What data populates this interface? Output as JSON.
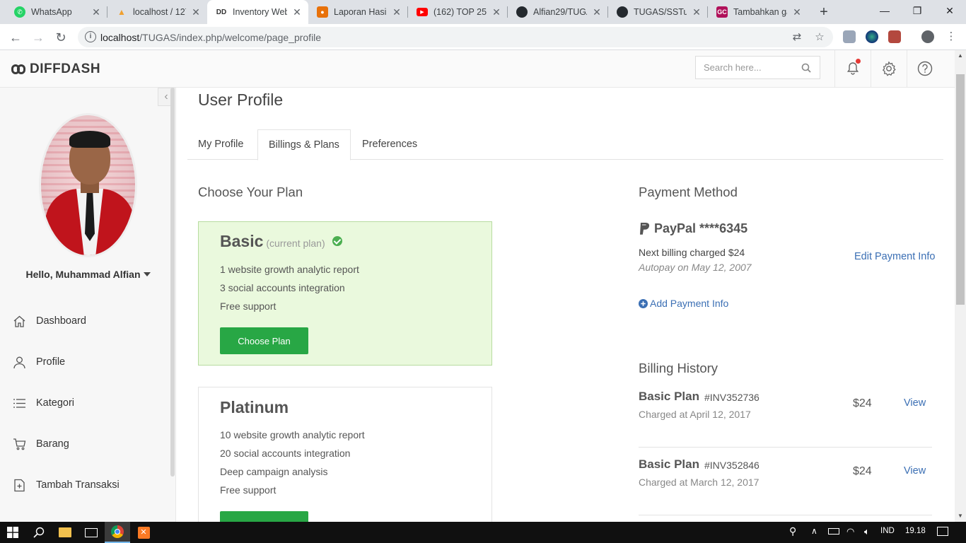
{
  "browser": {
    "tabs": [
      {
        "title": "WhatsApp",
        "favicon": "whatsapp-icon",
        "color": "#25d366"
      },
      {
        "title": "localhost / 127",
        "favicon": "phpmyadmin-icon",
        "color": "#f0a030"
      },
      {
        "title": "Inventory Web",
        "favicon": "dd",
        "color": "#333333",
        "active": true
      },
      {
        "title": "Laporan Hasil",
        "favicon": "person-icon",
        "color": "#e8710a"
      },
      {
        "title": "(162) TOP 25 C",
        "favicon": "youtube-icon",
        "color": "#ff0000"
      },
      {
        "title": "Alfian29/TUGA",
        "favicon": "github-icon",
        "color": "#24292e"
      },
      {
        "title": "TUGAS/SSTug",
        "favicon": "github-icon",
        "color": "#24292e"
      },
      {
        "title": "Tambahkan ga",
        "favicon": "gc",
        "color": "#b0115a"
      }
    ],
    "url_host": "localhost",
    "url_path": "/TUGAS/index.php/welcome/page_profile"
  },
  "header": {
    "logo_text": "DIFFDASH",
    "search_placeholder": "Search here..."
  },
  "sidebar": {
    "greeting": "Hello, Muhammad Alfian",
    "items": [
      {
        "label": "Dashboard",
        "icon": "home-icon"
      },
      {
        "label": "Profile",
        "icon": "user-icon"
      },
      {
        "label": "Kategori",
        "icon": "list-icon"
      },
      {
        "label": "Barang",
        "icon": "cart-icon"
      },
      {
        "label": "Tambah Transaksi",
        "icon": "add-file-icon"
      }
    ]
  },
  "main": {
    "title": "User Profile",
    "tabs": [
      "My Profile",
      "Billings & Plans",
      "Preferences"
    ],
    "active_tab": "Billings & Plans",
    "plans_heading": "Choose Your Plan",
    "plans": [
      {
        "name": "Basic",
        "note": "(current plan)",
        "features": [
          "1 website growth analytic report",
          "3 social accounts integration",
          "Free support"
        ],
        "button": "Choose Plan"
      },
      {
        "name": "Platinum",
        "features": [
          "10 website growth analytic report",
          "20 social accounts integration",
          "Deep campaign analysis",
          "Free support"
        ]
      }
    ],
    "payment": {
      "heading": "Payment Method",
      "method": "PayPal ****6345",
      "next_billing": "Next billing charged $24",
      "autopay": "Autopay on May 12, 2007",
      "edit_link": "Edit Payment Info",
      "add_link": "Add Payment Info"
    },
    "billing": {
      "heading": "Billing History",
      "rows": [
        {
          "plan": "Basic Plan",
          "invoice": "#INV352736",
          "date": "Charged at April 12, 2017",
          "amount": "$24",
          "action": "View"
        },
        {
          "plan": "Basic Plan",
          "invoice": "#INV352846",
          "date": "Charged at March 12, 2017",
          "amount": "$24",
          "action": "View"
        }
      ]
    }
  },
  "taskbar": {
    "language": "IND",
    "time": "19.18"
  },
  "colors": {
    "accent_green": "#28a745",
    "current_plan_bg": "#eaf9dd",
    "link_blue": "#3b6fb4"
  }
}
